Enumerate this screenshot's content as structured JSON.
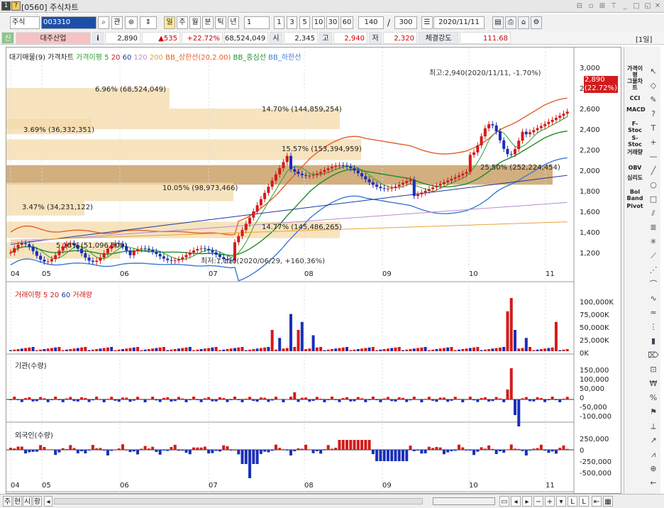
{
  "window": {
    "title_id": "[0560]",
    "title": "주식차트",
    "help_icon": "?",
    "number_icon": "1"
  },
  "toolbar": {
    "market": "주식",
    "code": "003310",
    "btn_search": "관",
    "periods": [
      "주",
      "월",
      "분",
      "틱",
      "년"
    ],
    "period_input": "1",
    "quick_periods": [
      "1",
      "3",
      "5",
      "10",
      "30",
      "60"
    ],
    "count": "140",
    "sep": "/",
    "total": "300",
    "date": "2020/11/11"
  },
  "infobar": {
    "badge": "신",
    "name": "대주산업",
    "info_icon": "i",
    "price": "2,890",
    "change": "▲535",
    "rate": "+22.72%",
    "volume": "68,524,049",
    "open_label": "시",
    "open": "2,345",
    "high_label": "고",
    "high": "2,940",
    "low_label": "저",
    "low": "2,320",
    "strength_label": "체결강도",
    "strength": "111.68",
    "period_tag": "[1일]"
  },
  "legends": {
    "price": [
      "대기매물(9)",
      "가격차트",
      "가격이평 5",
      "20",
      "60",
      "120",
      "200",
      "BB_상한선(20,2.00)",
      "BB_중심선",
      "BB_하한선"
    ],
    "volume": [
      "거래이평 5",
      "20",
      "60",
      "거래량"
    ],
    "inst": "기관(수량)",
    "foreign": "외국인(수량)"
  },
  "colors": {
    "up": "#d31b1b",
    "down": "#1a2fb8",
    "ma5": "#2ca02c",
    "ma20": "#c81e1e",
    "ma60": "#1f3b9c",
    "ma120": "#b98bd4",
    "ma200": "#e8a33a",
    "bb": "#e2602a",
    "bbmid": "#1c8c2a",
    "bblow": "#3a7bd5",
    "supply": "#f4d9a8",
    "supply_hot": "#c9a168",
    "accent": "#ffe89a"
  },
  "supply_bands": [
    "6.96% (68,524,049)",
    "14.70% (144,859,254)",
    "3.69% (36,332,351)",
    "15.57% (153,394,959)",
    "25.50% (252,224,454)",
    "10.05% (98,973,466)",
    "3.47% (34,231,122)",
    "14.77% (145,486,265)",
    "5.18% (51,096,500)"
  ],
  "annotations": {
    "high": "최고:2,940(2020/11/11, -1.70%)",
    "low": "최저:1,110(2020/06/29, +160.36%)"
  },
  "price_axis": [
    "3,000",
    "2,800",
    "2,600",
    "2,400",
    "2,200",
    "2,000",
    "1,800",
    "1,600",
    "1,400",
    "1,200"
  ],
  "price_tag": {
    "value": "2,890",
    "rate": "(22.72%)"
  },
  "volume_axis": [
    "100,000K",
    "75,000K",
    "50,000K",
    "25,000K",
    "0K"
  ],
  "inst_axis": [
    "150,000",
    "100,000",
    "50,000",
    "0",
    "-50,000",
    "-100,000"
  ],
  "foreign_axis": [
    "250,000",
    "0",
    "-250,000",
    "-500,000"
  ],
  "months": [
    "04",
    "05",
    "06",
    "07",
    "08",
    "09",
    "10",
    "11"
  ],
  "sidebar": {
    "buttons": [
      "가격이평",
      "그물차트",
      "CCI",
      "MACD",
      "F-Stoc",
      "S-Stoc",
      "거래량",
      "OBV",
      "심리도",
      "Bol Band",
      "Pivot"
    ]
  },
  "bottom": {
    "tabs": [
      "주",
      "현",
      "시",
      "황"
    ]
  }
}
